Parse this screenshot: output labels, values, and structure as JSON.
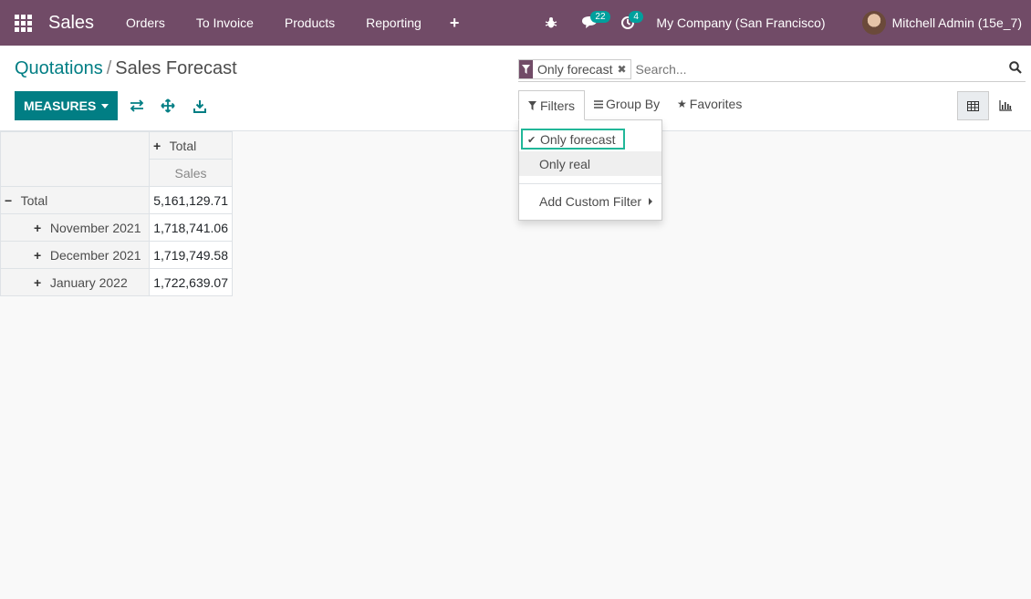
{
  "navbar": {
    "app_name": "Sales",
    "menus": [
      "Orders",
      "To Invoice",
      "Products",
      "Reporting"
    ],
    "plus": "+",
    "messages_count": "22",
    "activities_count": "4",
    "company": "My Company (San Francisco)",
    "user": "Mitchell Admin (15e_7)"
  },
  "breadcrumb": {
    "parent": "Quotations",
    "separator": "/",
    "current": "Sales Forecast"
  },
  "toolbar": {
    "measures_label": "MEASURES"
  },
  "search": {
    "facet_value": "Only forecast",
    "placeholder": "Search..."
  },
  "filter_bar": {
    "filters_label": "Filters",
    "groupby_label": "Group By",
    "favorites_label": "Favorites"
  },
  "filters_dropdown": {
    "items": [
      {
        "label": "Only forecast",
        "checked": true
      },
      {
        "label": "Only real",
        "checked": false
      }
    ],
    "custom_filter": "Add Custom Filter"
  },
  "pivot": {
    "col_header": "Total",
    "measure": "Sales",
    "total_label": "Total",
    "total_value": "5,161,129.71",
    "rows": [
      {
        "label": "November 2021",
        "value": "1,718,741.06"
      },
      {
        "label": "December 2021",
        "value": "1,719,749.58"
      },
      {
        "label": "January 2022",
        "value": "1,722,639.07"
      }
    ]
  },
  "colors": {
    "navbar": "#714b67",
    "primary": "#017e84",
    "badge": "#00a09d",
    "highlight": "#21b799"
  }
}
